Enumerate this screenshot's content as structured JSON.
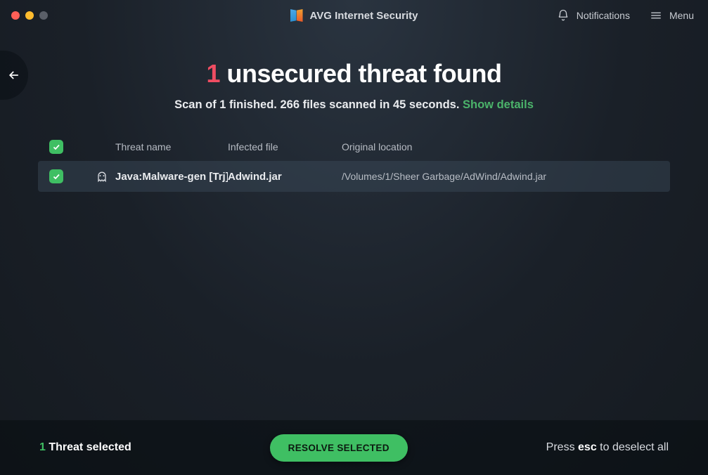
{
  "titlebar": {
    "app_name": "AVG Internet Security",
    "notifications_label": "Notifications",
    "menu_label": "Menu"
  },
  "headline": {
    "count": "1",
    "text": "unsecured threat found"
  },
  "subline": {
    "text": "Scan of 1 finished. 266 files scanned in 45 seconds. ",
    "link": "Show details"
  },
  "table": {
    "headers": {
      "threat": "Threat name",
      "file": "Infected file",
      "location": "Original location"
    },
    "rows": [
      {
        "threat": "Java:Malware-gen [Trj]",
        "file": "Adwind.jar",
        "location": "/Volumes/1/Sheer Garbage/AdWind/Adwind.jar"
      }
    ]
  },
  "footer": {
    "selected_count": "1",
    "selected_label": "Threat selected",
    "resolve_label": "RESOLVE SELECTED",
    "hint_prefix": "Press ",
    "hint_key": "esc",
    "hint_suffix": " to deselect all"
  }
}
